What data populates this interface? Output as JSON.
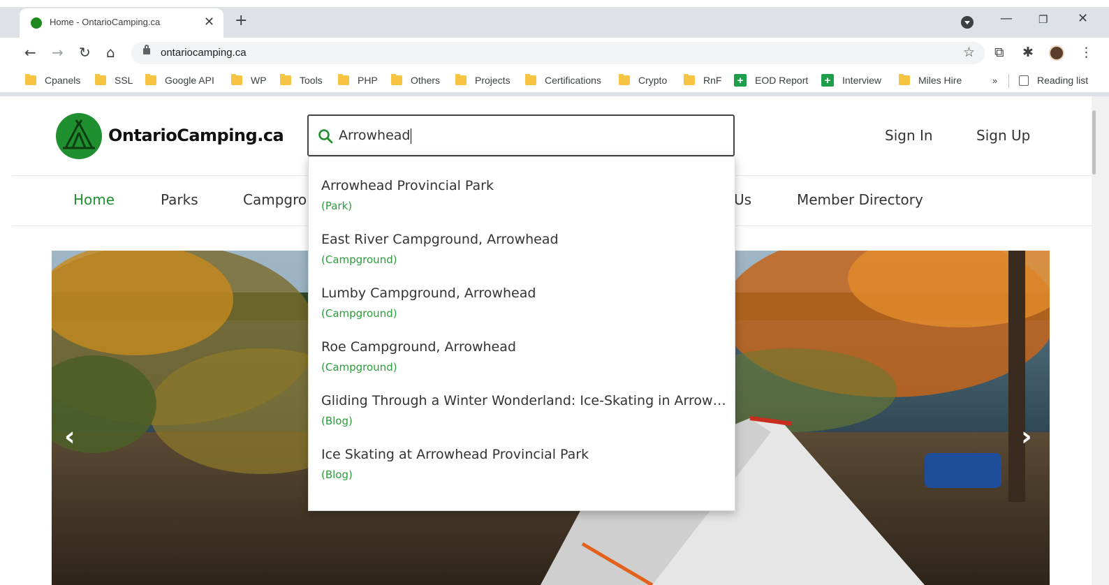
{
  "browser": {
    "tab_title": "Home - OntarioCamping.ca",
    "url": "ontariocamping.ca",
    "bookmarks": [
      {
        "label": "Cpanels",
        "type": "folder"
      },
      {
        "label": "SSL",
        "type": "folder"
      },
      {
        "label": "Google API",
        "type": "folder"
      },
      {
        "label": "WP",
        "type": "folder"
      },
      {
        "label": "Tools",
        "type": "folder"
      },
      {
        "label": "PHP",
        "type": "folder"
      },
      {
        "label": "Others",
        "type": "folder"
      },
      {
        "label": "Projects",
        "type": "folder"
      },
      {
        "label": "Certifications",
        "type": "folder"
      },
      {
        "label": "Crypto",
        "type": "folder"
      },
      {
        "label": "RnF",
        "type": "folder"
      },
      {
        "label": "EOD Report",
        "type": "sheet"
      },
      {
        "label": "Interview",
        "type": "sheet"
      },
      {
        "label": "Miles Hire",
        "type": "folder"
      }
    ],
    "overflow_label": "»",
    "reading_list_label": "Reading list"
  },
  "site": {
    "logo_text": "OntarioCamping.ca",
    "search_value": "Arrowhead",
    "sign_in": "Sign In",
    "sign_up": "Sign Up",
    "nav": {
      "home": "Home",
      "parks": "Parks",
      "campgrounds_partial": "Campgro",
      "contact_partial": "Us",
      "member_directory": "Member Directory"
    },
    "accent_color": "#208f2f",
    "results": [
      {
        "title": "Arrowhead Provincial Park",
        "type": "(Park)"
      },
      {
        "title": "East River Campground, Arrowhead",
        "type": "(Campground)"
      },
      {
        "title": "Lumby Campground, Arrowhead",
        "type": "(Campground)"
      },
      {
        "title": "Roe Campground, Arrowhead",
        "type": "(Campground)"
      },
      {
        "title": "Gliding Through a Winter Wonderland: Ice-Skating in Arrowhe...",
        "type": "(Blog)"
      },
      {
        "title": "Ice Skating at Arrowhead Provincial Park",
        "type": "(Blog)"
      }
    ]
  }
}
